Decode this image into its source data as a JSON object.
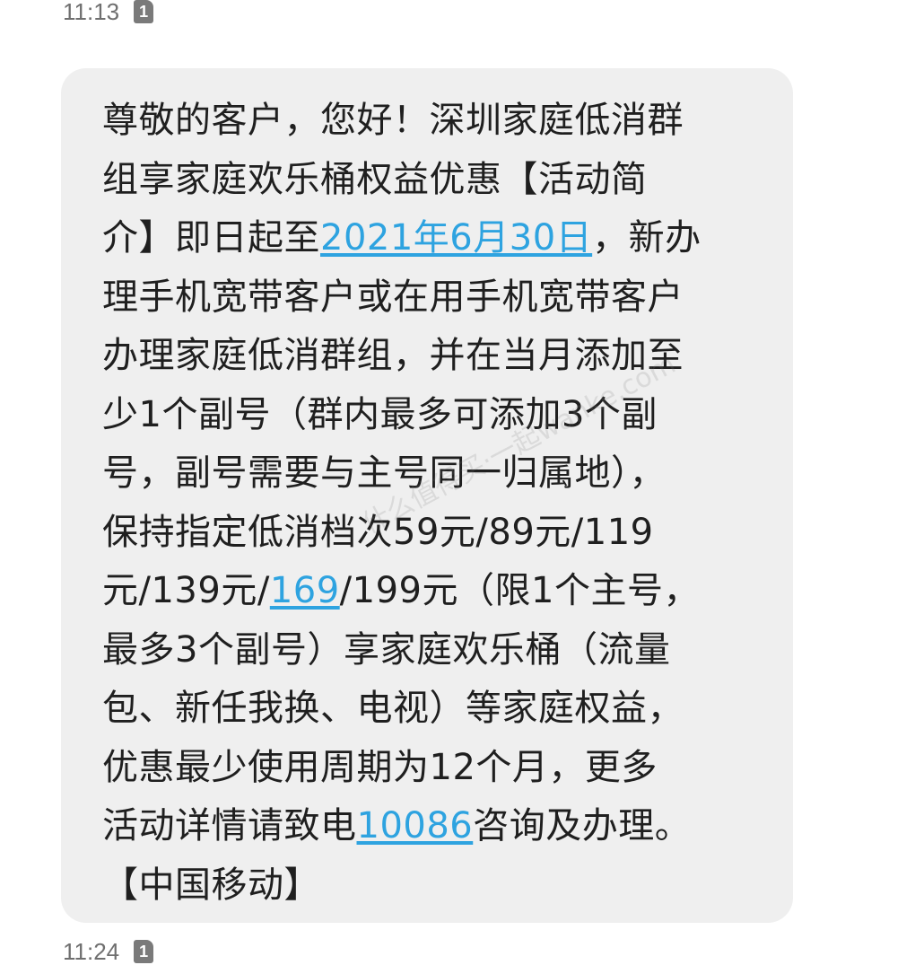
{
  "header": {
    "time": "11:13",
    "sim_badge": "1"
  },
  "message": {
    "lines": [
      [
        "尊敬的客户，您好！深圳家庭低消群"
      ],
      [
        "组享家庭欢乐桶权益优惠【活动简"
      ],
      [
        "介】即日起至",
        {
          "link": "2021年6月30日"
        },
        "，新办"
      ],
      [
        "理手机宽带客户或在用手机宽带客户"
      ],
      [
        "办理家庭低消群组，并在当月添加至"
      ],
      [
        "少1个副号（群内最多可添加3个副"
      ],
      [
        "号，副号需要与主号同一归属地），"
      ],
      [
        "保持指定低消档次59元/89元/119"
      ],
      [
        "元/139元/",
        {
          "link": "169"
        },
        "/199元（限1个主号，"
      ],
      [
        "最多3个副号）享家庭欢乐桶（流量"
      ],
      [
        "包、新任我换、电视）等家庭权益，"
      ],
      [
        "优惠最少使用周期为12个月，更多"
      ],
      [
        "活动详情请致电",
        {
          "link": "10086"
        },
        "咨询及办理。"
      ],
      [
        "【中国移动】"
      ]
    ]
  },
  "watermark": "什么值得买·一起wanke.com",
  "footer": {
    "time": "11:24",
    "sim_badge": "1"
  },
  "colors": {
    "bubble": "#efefef",
    "text": "#1f1f1f",
    "link": "#2ea3e0",
    "meta": "#6f6f6f"
  }
}
